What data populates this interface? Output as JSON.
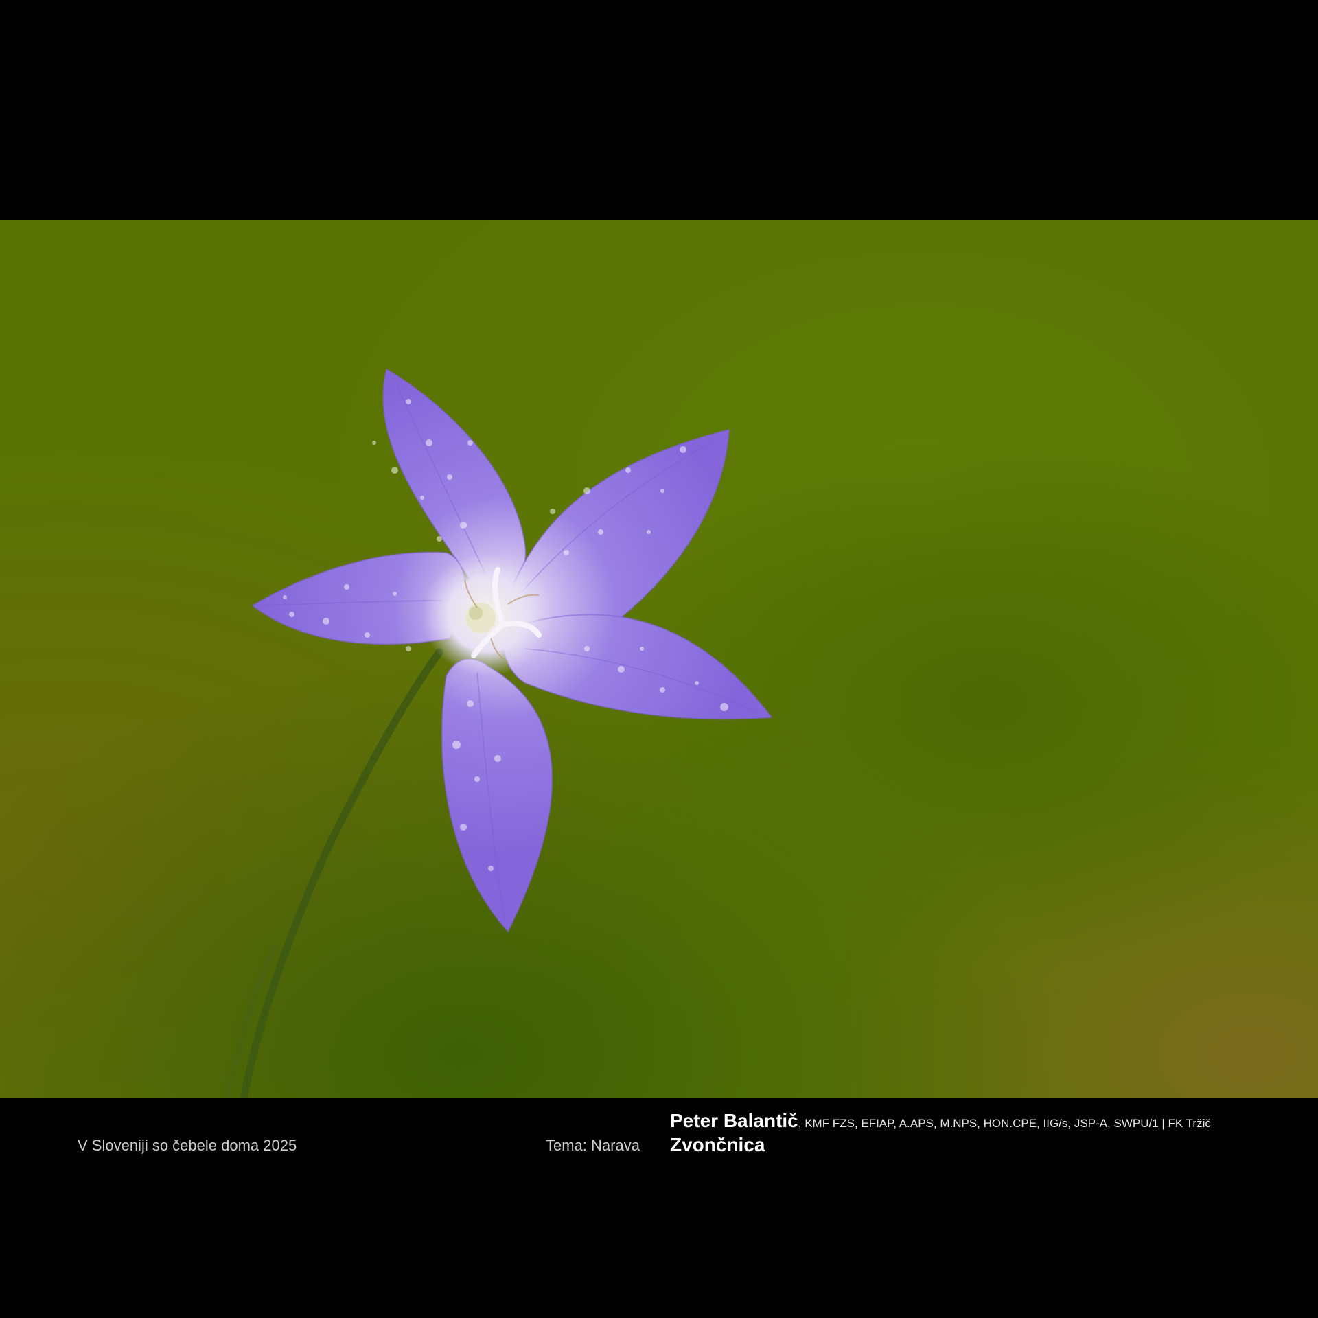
{
  "footer": {
    "project": "V Sloveniji so čebele doma 2025",
    "theme": "Tema: Narava",
    "author_name": "Peter Balantič",
    "author_credits": ", KMF FZS, EFIAP, A.APS, M.NPS, HON.CPE, IIG/s, JSP-A, SWPU/1 | FK Tržič",
    "photo_title": "Zvončnica"
  },
  "colors": {
    "frame": "#000000",
    "background_green": "#5a7404",
    "petal_purple": "#8c6ee0",
    "flower_center": "#ece6f6",
    "stem": "#3e5a12",
    "caption_text": "#ffffff",
    "caption_muted": "#cfcfcf"
  }
}
